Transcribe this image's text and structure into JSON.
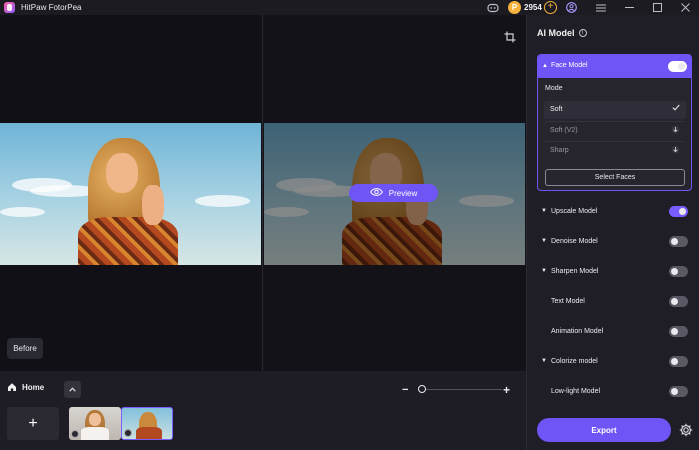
{
  "app": {
    "title": "HitPaw FotorPea"
  },
  "titlebar": {
    "credits": "2954",
    "icons": [
      "discord-icon",
      "coin-icon",
      "add-credits-icon",
      "account-icon",
      "menu-icon",
      "minimize-icon",
      "maximize-icon",
      "close-icon"
    ]
  },
  "canvas": {
    "preview_label": "Preview",
    "before_label": "Before"
  },
  "bottombar": {
    "home_label": "Home",
    "add_label": "+",
    "zoom_percent": 0
  },
  "panel": {
    "title": "AI Model",
    "face_model": {
      "label": "Face Model",
      "enabled": true,
      "mode_label": "Mode",
      "modes": [
        {
          "label": "Soft",
          "state": "selected"
        },
        {
          "label": "Soft (V2)",
          "state": "download"
        },
        {
          "label": "Sharp",
          "state": "download"
        }
      ],
      "select_faces_label": "Select Faces"
    },
    "models": [
      {
        "label": "Upscale Model",
        "expandable": true,
        "enabled": true
      },
      {
        "label": "Denoise Model",
        "expandable": true,
        "enabled": false
      },
      {
        "label": "Sharpen Model",
        "expandable": true,
        "enabled": false
      },
      {
        "label": "Text Model",
        "expandable": false,
        "enabled": false
      },
      {
        "label": "Animation Model",
        "expandable": false,
        "enabled": false
      },
      {
        "label": "Colorize model",
        "expandable": true,
        "enabled": false
      },
      {
        "label": "Low-light Model",
        "expandable": false,
        "enabled": false
      }
    ],
    "export_label": "Export"
  },
  "colors": {
    "accent": "#6f55f5",
    "coin": "#f6b23c",
    "panel_bg": "#1f1e26",
    "canvas_bg": "#101016"
  }
}
